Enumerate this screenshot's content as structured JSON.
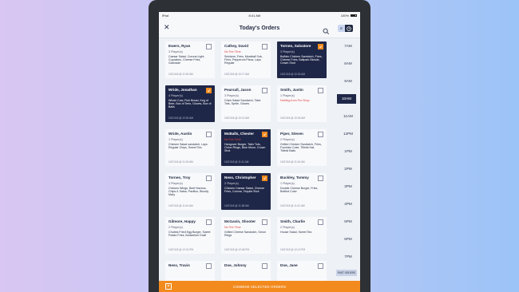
{
  "status": {
    "carrier": "iPad",
    "time": "8:41 AM",
    "battery": "100%"
  },
  "header": {
    "title": "Today's Orders"
  },
  "orders": [
    {
      "name": "Ewers, Ryan",
      "players": "3 Player(s)",
      "items": "Caesar Salad, Corona Light, Cupcakes, Cheese Fries, Gatorade",
      "time": "10/21/18 @ 11:53 AM",
      "selected": false
    },
    {
      "name": "Cathey, David",
      "players": "No Tee Time",
      "items": "Snickers, Fries, Meatball Sub, Fries, Pepperoni Pizza, Lays Regular",
      "time": "10/21/18 @ 10:17 AM",
      "selected": false,
      "no_tee": true
    },
    {
      "name": "Torneo, Salvatore",
      "players": "3 Player(s)",
      "items": "Buffalo Chicken Sandwich, Fries, Cheese Fries, Ballpark Blonde, Crown Shot",
      "time": "10/21/18 @ 10:30 AM",
      "selected": true
    },
    {
      "name": "Wride, Jonathan",
      "players": "4 Player(s)",
      "items": "Whole Cow, Fish Bread, Keg of Beer, Box of Tees, Gloves, Box of Balls",
      "time": "10/21/18 @ 10:52 AM",
      "selected": true
    },
    {
      "name": "Pearsall, Jason",
      "players": "3 Player(s)",
      "items": "Chick Salad Sandwich, Tater Tots, Sprite, Gloves",
      "time": "10/21/18 @ 10:12 AM",
      "selected": false
    },
    {
      "name": "Smith, Justin",
      "players": "1 Player(s)",
      "items": "Nothing from Pro Shop",
      "time": "10/21/18 @ 10:00 AM",
      "selected": false,
      "no_items": true
    },
    {
      "name": "Wride, Austin",
      "players": "1 Player(s)",
      "items": "Chicken Salad sandwich, Lays Regular Chips, Sweet Tea",
      "time": "10/21/18 @ 11:03 AM",
      "selected": false
    },
    {
      "name": "McBalls, Chester",
      "players": "No Tee Time",
      "items": "Hangover Burger, Tater Tots, Onion Rings, Blue Moon, Crown Shot",
      "time": "10/21/18 @ 11:11 AM",
      "selected": true,
      "no_tee": true
    },
    {
      "name": "Piper, Steven",
      "players": "2 Player(s)",
      "items": "Grilled Chicken Sandwich, Fries, Fountain Coke, Titleist Hat, Titleist Balls",
      "time": "10/21/18 @ 11:16 AM",
      "selected": false
    },
    {
      "name": "Torneo, Troy",
      "players": "4 Player(s)",
      "items": "Chicken Wings, Beef Nachos, Chips & Salsa, Pacifico, Bloody Mary",
      "time": "10/21/18 @ 11:44 AM",
      "selected": false
    },
    {
      "name": "Ness, Christopher",
      "players": "2 Player(s)",
      "items": "Chicken Caesar Salad, Cheese Fries, Corona, Tequila Shot",
      "time": "10/21/18 @ 11:38 AM",
      "selected": true
    },
    {
      "name": "Buckley, Tommy",
      "players": "1 Player(s)",
      "items": "Double Cheese Burger, Fries, Bottled Coke",
      "time": "10/21/18 @ 11:41 AM",
      "selected": false
    },
    {
      "name": "Gilmore, Happy",
      "players": "2 Player(s)",
      "items": "Chubbs Fried Egg Burger, Sweet Potato Fries, Budweiser Draft",
      "time": "10/21/18 @ 12:01 PM",
      "selected": false
    },
    {
      "name": "McGavin, Shooter",
      "players": "No Tee Time",
      "items": "Grilled Cheese Sandwich, Onion Rings",
      "time": "10/21/18 @ 12:06 PM",
      "selected": false,
      "no_tee": true
    },
    {
      "name": "Smith, Charlie",
      "players": "2 Player(s)",
      "items": "House Salad, Sweet Tea",
      "time": "10/21/18 @ 12:13 PM",
      "selected": false
    },
    {
      "name": "Ness, Travis",
      "players": "",
      "items": "",
      "time": "",
      "selected": false
    },
    {
      "name": "Doe, Johnny",
      "players": "",
      "items": "",
      "time": "",
      "selected": false
    },
    {
      "name": "Doe, Jane",
      "players": "",
      "items": "",
      "time": "",
      "selected": false
    }
  ],
  "timeline": [
    "7AM",
    "8AM",
    "9AM",
    "10AM",
    "11AM",
    "12PM",
    "1PM",
    "2PM",
    "3PM",
    "4PM",
    "5PM",
    "6PM",
    "7PM"
  ],
  "timeline_active": "10AM",
  "past_orders_label": "PAST ORDERS",
  "footer": {
    "label": "COMBINE SELECTED ORDERS"
  },
  "colors": {
    "accent": "#f28a1d",
    "navy": "#1f2748",
    "no_tee": "#e23e3e"
  },
  "icons": {
    "close": "close-icon",
    "search": "search-icon",
    "list": "list-icon",
    "clock": "clock-icon",
    "check": "checkmark-icon"
  }
}
